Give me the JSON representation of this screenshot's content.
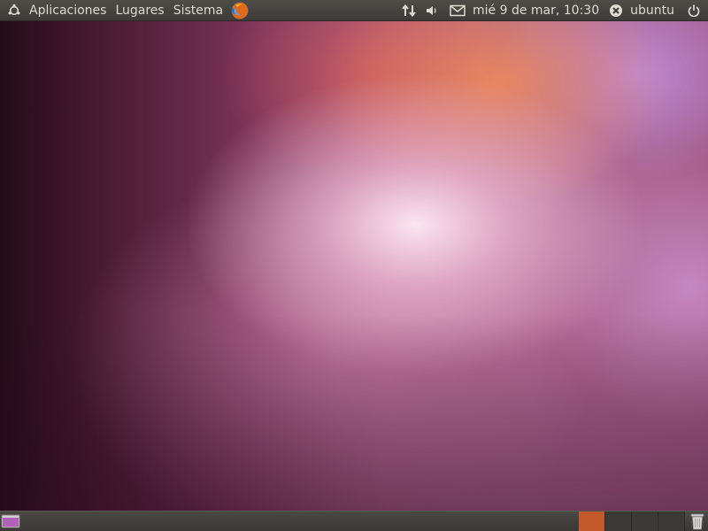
{
  "top_panel": {
    "menus": {
      "applications": "Aplicaciones",
      "places": "Lugares",
      "system": "Sistema"
    },
    "clock": "mié 9 de mar, 10:30",
    "user": "ubuntu"
  },
  "bottom_panel": {
    "workspaces": 4,
    "active_workspace": 1
  },
  "colors": {
    "panel": "#3c3b37",
    "panel_text": "#dfdbd2",
    "active_workspace": "#c4592b",
    "wallpaper_accent": "#a6587f"
  },
  "icons": {
    "ubuntu_logo": "ubuntu-logo-icon",
    "browser": "firefox-icon",
    "network": "network-arrows-icon",
    "volume": "volume-icon",
    "mail": "mail-envelope-icon",
    "status": "user-status-icon",
    "power": "power-icon",
    "show_desktop": "show-desktop-icon",
    "trash": "trash-icon"
  }
}
